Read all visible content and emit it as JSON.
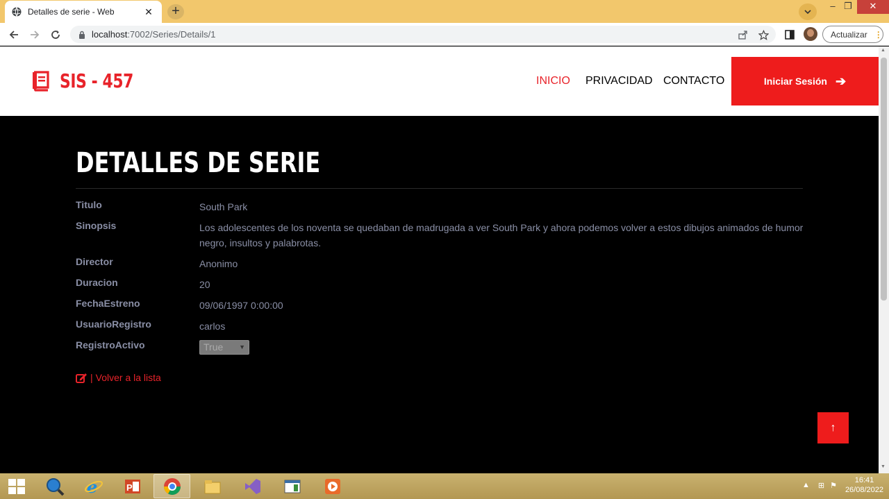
{
  "browser": {
    "tab_title": "Detalles de serie - Web",
    "url_host": "localhost",
    "url_path": ":7002/Series/Details/1",
    "update_label": "Actualizar"
  },
  "site": {
    "brand": "SIS - 457",
    "nav": [
      "INICIO",
      "PRIVACIDAD",
      "CONTACTO"
    ],
    "login_label": "Iniciar Sesión",
    "accent_color": "#ee1c1c"
  },
  "page": {
    "title": "DETALLES DE SERIE",
    "fields": [
      {
        "label": "Titulo",
        "value": "South Park"
      },
      {
        "label": "Sinopsis",
        "value": "Los adolescentes de los noventa se quedaban de madrugada a ver South Park y ahora podemos volver a estos dibujos animados de humor negro, insultos y palabrotas."
      },
      {
        "label": "Director",
        "value": "Anonimo"
      },
      {
        "label": "Duracion",
        "value": "20"
      },
      {
        "label": "FechaEstreno",
        "value": "09/06/1997 0:00:00"
      },
      {
        "label": "UsuarioRegistro",
        "value": "carlos"
      },
      {
        "label": "RegistroActivo",
        "value": "True"
      }
    ],
    "back_separator": "|",
    "back_link": "Volver a la lista"
  },
  "taskbar": {
    "time": "16:41",
    "date": "26/08/2022"
  }
}
